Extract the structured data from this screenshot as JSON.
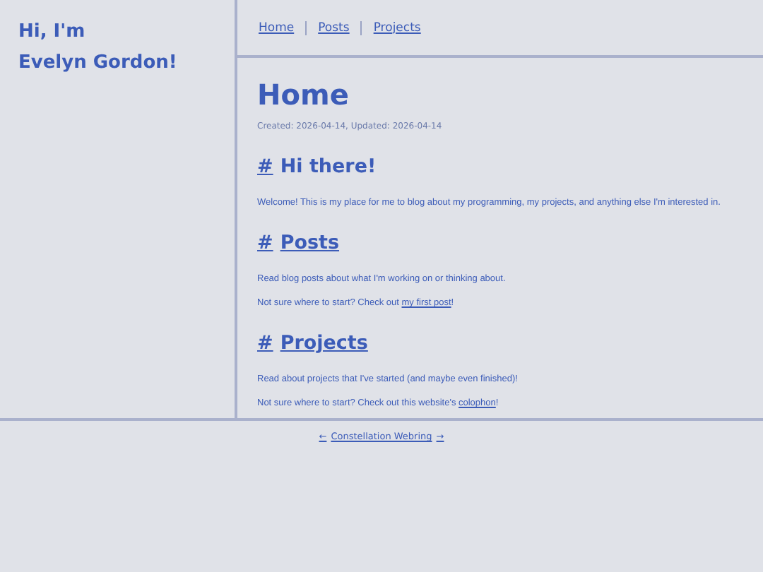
{
  "sidebar": {
    "greeting": [
      "Hi, I'm",
      "Evelyn Gordon!"
    ]
  },
  "nav": [
    {
      "label": "Home"
    },
    {
      "label": "Posts"
    },
    {
      "label": "Projects"
    }
  ],
  "page": {
    "title": "Home",
    "meta": "Created: 2026-04-14, Updated: 2026-04-14"
  },
  "sections": [
    {
      "anchor": "#",
      "heading": "Hi there!",
      "linked": false,
      "paragraphs": [
        {
          "text": "Welcome! This is my place for me to blog about my programming, my projects, and anything else I'm interested in."
        }
      ]
    },
    {
      "anchor": "#",
      "heading": "Posts",
      "linked": true,
      "paragraphs": [
        {
          "text": "Read blog posts about what I'm working on or thinking about."
        },
        {
          "text": "Not sure where to start? Check out ",
          "link": "my first post",
          "after": "!"
        }
      ]
    },
    {
      "anchor": "#",
      "heading": "Projects",
      "linked": true,
      "paragraphs": [
        {
          "text": "Read about projects that I've started (and maybe even finished)!"
        },
        {
          "text": "Not sure where to start? Check out this website's ",
          "link": "colophon",
          "after": "!"
        }
      ]
    }
  ],
  "footer": {
    "prev": "←",
    "webring": "Constellation Webring",
    "next": "→"
  }
}
